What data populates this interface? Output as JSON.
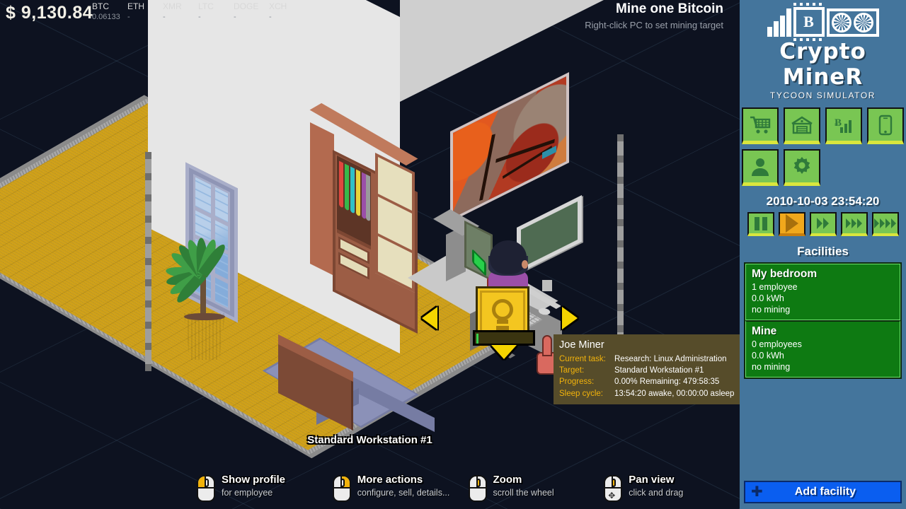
{
  "hud": {
    "money": "$ 9,130.84",
    "tickers": [
      {
        "name": "BTC",
        "value": "0.06133"
      },
      {
        "name": "ETH",
        "value": "-"
      },
      {
        "name": "XMR",
        "value": "-"
      },
      {
        "name": "LTC",
        "value": "-"
      },
      {
        "name": "DOGE",
        "value": "-"
      },
      {
        "name": "XCH",
        "value": "-"
      }
    ]
  },
  "mission": {
    "title": "Mine one Bitcoin",
    "subtitle": "Right-click PC to set mining target"
  },
  "scene": {
    "workstation_label": "Standard Workstation #1"
  },
  "tooltip": {
    "name": "Joe Miner",
    "rows": [
      {
        "key": "Current task:",
        "value": "Research: Linux Administration"
      },
      {
        "key": "Target:",
        "value": "Standard Workstation #1"
      },
      {
        "key": "Progress:",
        "value": "0.00%  Remaining: 479:58:35"
      },
      {
        "key": "Sleep cycle:",
        "value": "13:54:20 awake, 00:00:00 asleep"
      }
    ]
  },
  "hints": [
    {
      "title": "Show profile",
      "sub": "for employee",
      "mouse": "left-button"
    },
    {
      "title": "More actions",
      "sub": "configure, sell, details...",
      "mouse": "right-button"
    },
    {
      "title": "Zoom",
      "sub": "scroll the wheel",
      "mouse": "scroll-wheel"
    },
    {
      "title": "Pan view",
      "sub": "click and drag",
      "mouse": "wheel-drag"
    }
  ],
  "sidebar": {
    "logo": {
      "title": "Crypto MineR",
      "subtitle": "TYCOON SIMULATOR",
      "chip_letter": "B"
    },
    "nav": [
      {
        "name": "shop-cart-icon",
        "label": "Shop"
      },
      {
        "name": "warehouse-icon",
        "label": "Facilities"
      },
      {
        "name": "bitcoin-chart-icon",
        "label": "Market"
      },
      {
        "name": "phone-icon",
        "label": "Phone"
      },
      {
        "name": "person-icon",
        "label": "Employees"
      },
      {
        "name": "gear-icon",
        "label": "Settings"
      }
    ],
    "clock": "2010-10-03 23:54:20",
    "speeds": [
      {
        "name": "pause",
        "active": false
      },
      {
        "name": "play",
        "active": true
      },
      {
        "name": "fast-2x",
        "active": false
      },
      {
        "name": "fast-3x",
        "active": false
      },
      {
        "name": "fast-4x",
        "active": false
      }
    ],
    "facilities_title": "Facilities",
    "facilities": [
      {
        "name": "My bedroom",
        "employees": "1 employee",
        "power": "0.0 kWh",
        "mining": "no mining"
      },
      {
        "name": "Mine",
        "employees": "0 employees",
        "power": "0.0 kWh",
        "mining": "no mining"
      }
    ],
    "add_facility": "Add facility"
  },
  "colors": {
    "background": "#0d1220",
    "sidebar": "#44759c",
    "green_button": "#79c653",
    "active_speed": "#f0a81c",
    "facility": "#0e7a12",
    "add_facility": "#0a5ef0",
    "tooltip": "#564c2a",
    "accent_yellow": "#f2b30b",
    "floor": "#cfa018"
  }
}
